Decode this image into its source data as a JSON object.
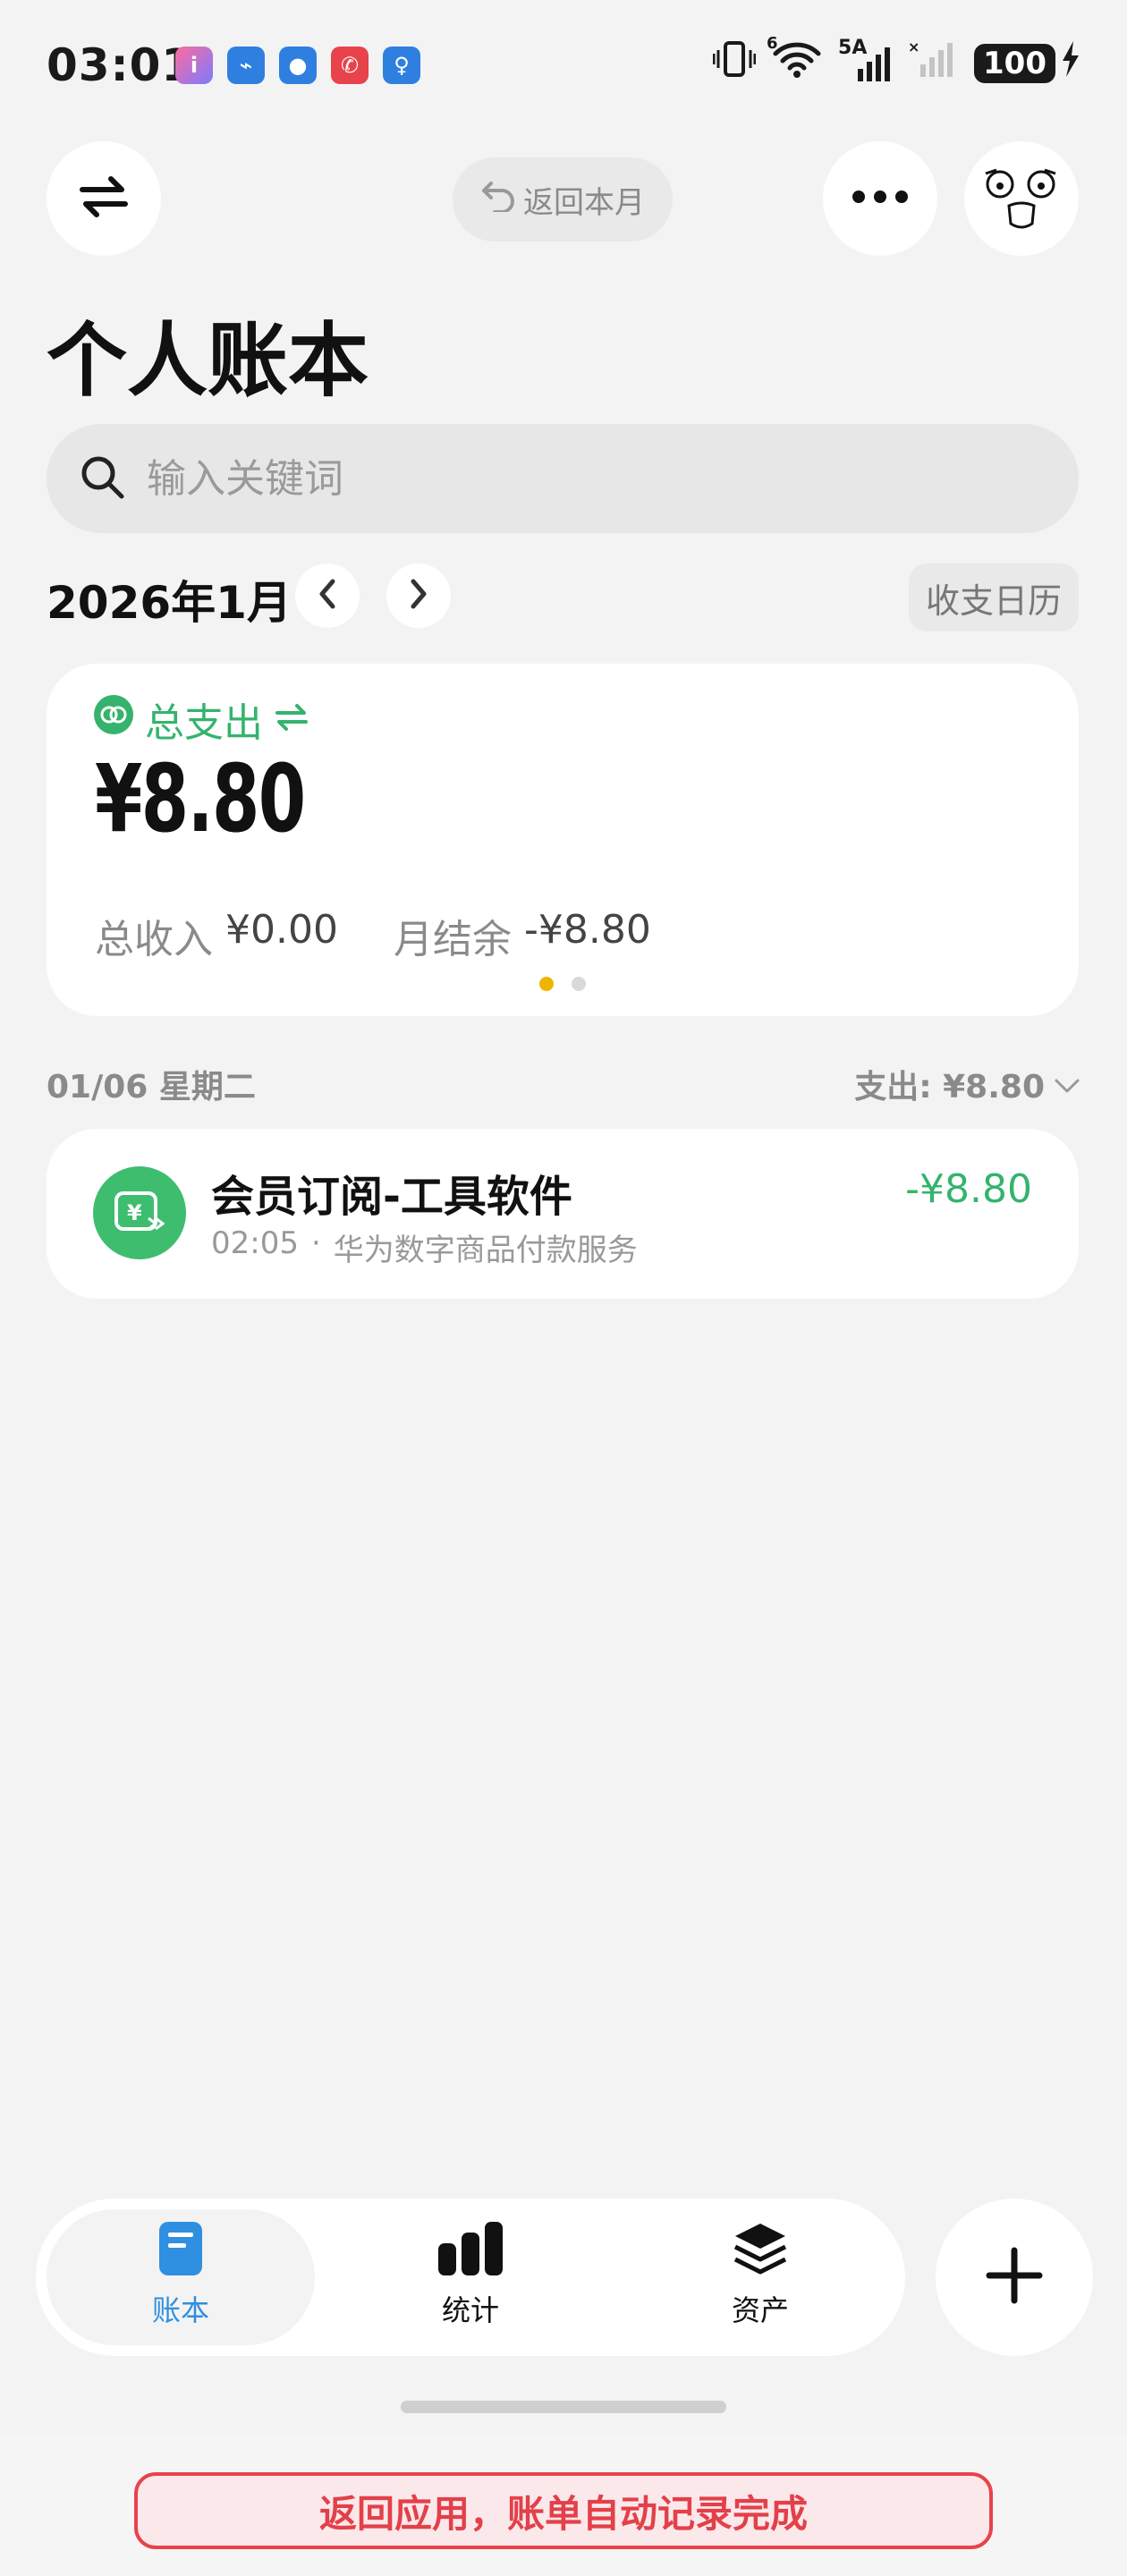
{
  "status_bar": {
    "time": "03:01",
    "network": "5A",
    "network_small": "6",
    "battery": "100"
  },
  "toolbar": {
    "switch_icon": "swap-arrows-icon",
    "back_to_month_label": "返回本月",
    "more_icon": "more-dots-icon",
    "avatar_icon": "avatar-face-icon"
  },
  "page": {
    "title": "个人账本"
  },
  "search": {
    "placeholder": "输入关键词"
  },
  "month_nav": {
    "label": "2026年1月",
    "calendar_button": "收支日历"
  },
  "summary": {
    "type_label": "总支出",
    "amount": "¥8.80",
    "income_label": "总收入",
    "income_value": "¥0.00",
    "balance_label": "月结余",
    "balance_value": "-¥8.80",
    "colors": {
      "accent": "#35b36d",
      "dot_active": "#f0b400",
      "dot_inactive": "#d9d9d9"
    }
  },
  "day_group": {
    "date": "01/06 星期二",
    "total": "支出: ¥8.80"
  },
  "transactions": [
    {
      "title": "会员订阅-工具软件",
      "time": "02:05",
      "separator": "·",
      "merchant": "华为数字商品付款服务",
      "amount": "-¥8.80"
    }
  ],
  "bottom_nav": {
    "tabs": [
      {
        "label": "账本",
        "icon": "ledger-book-icon",
        "active": true
      },
      {
        "label": "统计",
        "icon": "bar-chart-icon",
        "active": false
      },
      {
        "label": "资产",
        "icon": "layers-stack-icon",
        "active": false
      }
    ],
    "add_icon": "plus-icon",
    "active_color": "#2f8fe0"
  },
  "banner": {
    "text": "返回应用，账单自动记录完成"
  }
}
